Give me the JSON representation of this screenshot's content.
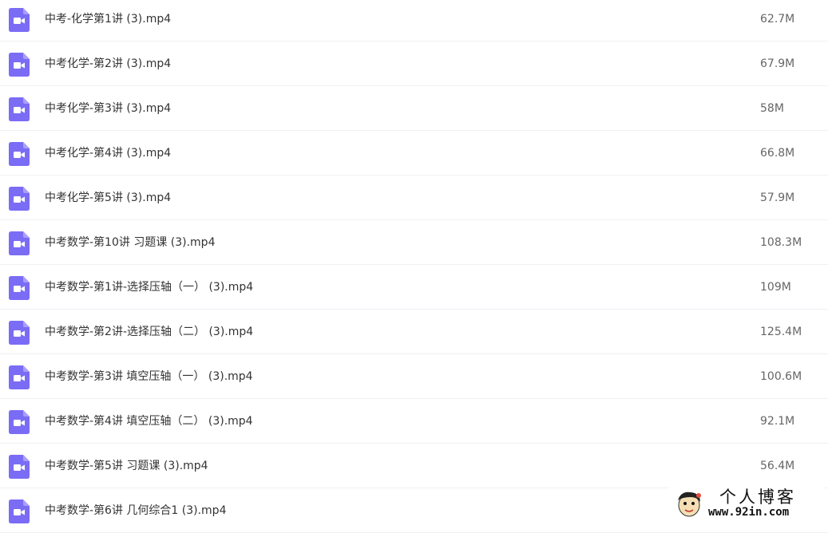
{
  "files": [
    {
      "name": "中考-化学第1讲 (3).mp4",
      "size": "62.7M",
      "icon": "video-file-icon"
    },
    {
      "name": "中考化学-第2讲 (3).mp4",
      "size": "67.9M",
      "icon": "video-file-icon"
    },
    {
      "name": "中考化学-第3讲 (3).mp4",
      "size": "58M",
      "icon": "video-file-icon"
    },
    {
      "name": "中考化学-第4讲 (3).mp4",
      "size": "66.8M",
      "icon": "video-file-icon"
    },
    {
      "name": "中考化学-第5讲 (3).mp4",
      "size": "57.9M",
      "icon": "video-file-icon"
    },
    {
      "name": "中考数学-第10讲 习题课 (3).mp4",
      "size": "108.3M",
      "icon": "video-file-icon"
    },
    {
      "name": "中考数学-第1讲-选择压轴（一） (3).mp4",
      "size": "109M",
      "icon": "video-file-icon"
    },
    {
      "name": "中考数学-第2讲-选择压轴（二） (3).mp4",
      "size": "125.4M",
      "icon": "video-file-icon"
    },
    {
      "name": "中考数学-第3讲 填空压轴（一） (3).mp4",
      "size": "100.6M",
      "icon": "video-file-icon"
    },
    {
      "name": "中考数学-第4讲 填空压轴（二） (3).mp4",
      "size": "92.1M",
      "icon": "video-file-icon"
    },
    {
      "name": "中考数学-第5讲 习题课 (3).mp4",
      "size": "56.4M",
      "icon": "video-file-icon"
    },
    {
      "name": "中考数学-第6讲 几何综合1 (3).mp4",
      "size": "",
      "icon": "video-file-icon"
    }
  ],
  "watermark": {
    "title": "个人博客",
    "url": "www.92in.com"
  },
  "colors": {
    "icon": "#7b6cf6",
    "text": "#333333",
    "size_text": "#666666",
    "divider": "#f0f0f5"
  }
}
